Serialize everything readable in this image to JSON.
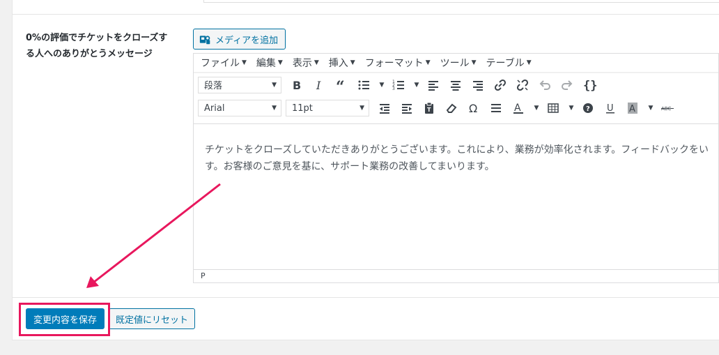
{
  "field": {
    "label": "0%の評価でチケットをクローズする人へのありがとうメッセージ"
  },
  "media_button": {
    "label": "メディアを追加",
    "icon": "media-icon"
  },
  "editor": {
    "menu": [
      {
        "label": "ファイル"
      },
      {
        "label": "編集"
      },
      {
        "label": "表示"
      },
      {
        "label": "挿入"
      },
      {
        "label": "フォーマット"
      },
      {
        "label": "ツール"
      },
      {
        "label": "テーブル"
      }
    ],
    "format_select": "段落",
    "font_select": "Arial",
    "size_select": "11pt",
    "content_line1": "チケットをクローズしていただきありがとうございます。これにより、業務が効率化されます。フィードバックをい",
    "content_line2": "す。お客様のご意見を基に、サポート業務の改善してまいります。",
    "status_path": "P"
  },
  "actions": {
    "save_label": "変更内容を保存",
    "reset_label": "既定値にリセット"
  },
  "colors": {
    "primary": "#007cba",
    "annotation": "#e8175d"
  }
}
